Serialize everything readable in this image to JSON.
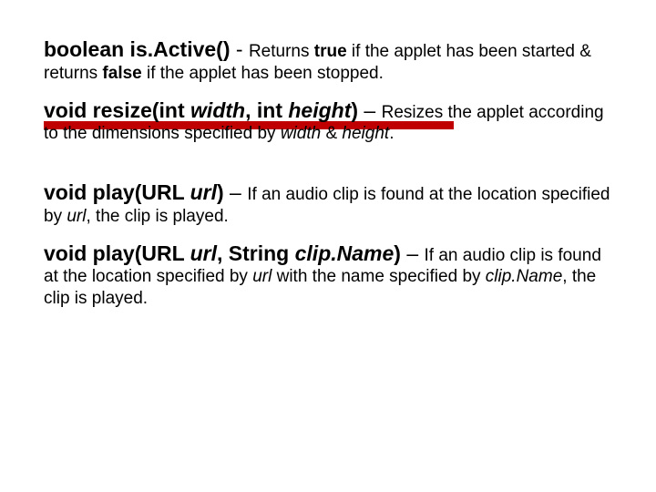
{
  "entries": [
    {
      "sig_a": "boolean is.Active()",
      "dash": " - ",
      "d1": "Returns ",
      "d2": "true",
      "d3": " if the applet has been started & returns ",
      "d4": "false",
      "d5": " if the applet has been stopped."
    },
    {
      "sig_a": "void resize(int ",
      "sig_b": "width",
      "sig_c": ", int ",
      "sig_d": "height",
      "sig_e": ")",
      "dash": " – ",
      "d1": "Resizes the applet according to the dimensions specified by ",
      "d2": "width",
      "d3": " & ",
      "d4": "height",
      "d5": "."
    },
    {
      "sig_a": "void play(URL ",
      "sig_b": "url",
      "sig_c": ")",
      "dash": " – ",
      "d1": "If an audio clip is found at the location specified by ",
      "d2": "url",
      "d3": ", the clip is played."
    },
    {
      "sig_a": "void play(URL ",
      "sig_b": "url",
      "sig_c": ", String ",
      "sig_d": "clip.Name",
      "sig_e": ")",
      "dash": " – ",
      "d1": "If an audio clip is found at the location specified by ",
      "d2": "url",
      "d3": " with the name specified by ",
      "d4": "clip.Name",
      "d5": ", the clip is played."
    }
  ]
}
